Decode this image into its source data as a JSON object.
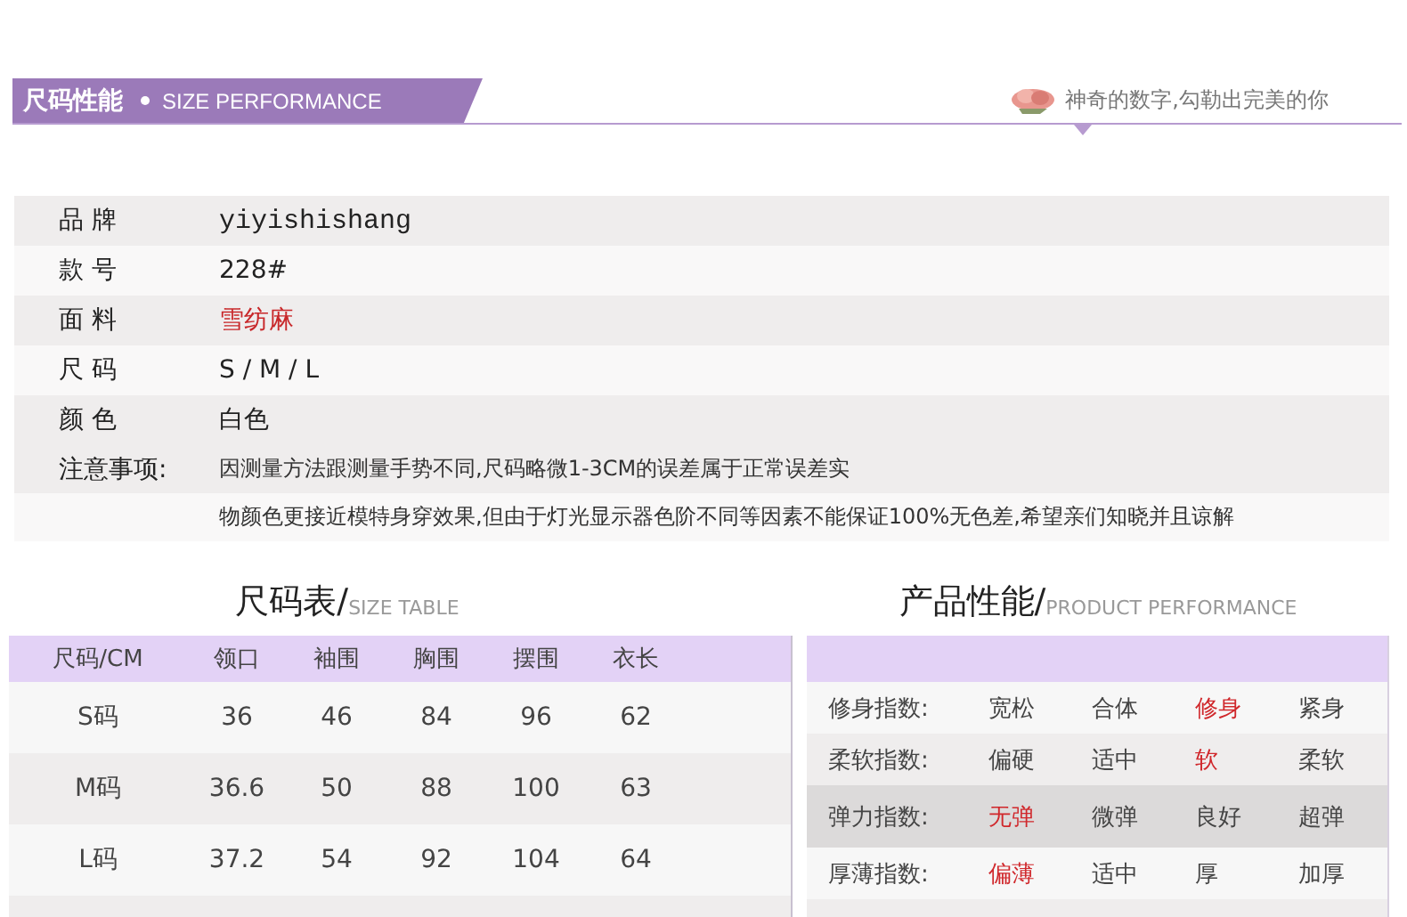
{
  "header": {
    "title": "尺码性能",
    "subtitle": "SIZE PERFORMANCE",
    "slogan": "神奇的数字,勾勒出完美的你"
  },
  "info": [
    {
      "label": "品 牌",
      "value": "yiyishishang",
      "kind": "mono"
    },
    {
      "label": "款 号",
      "value": "228#",
      "kind": "plain"
    },
    {
      "label": "面 料",
      "value": "雪纺麻",
      "kind": "highlight"
    },
    {
      "label": "尺 码",
      "value": "S / M / L",
      "kind": "plain"
    },
    {
      "label": "颜 色",
      "value": "白色",
      "kind": "plain"
    }
  ],
  "notes": {
    "label": "注意事项:",
    "lines": [
      "因测量方法跟测量手势不同,尺码略微1-3CM的误差属于正常误差实",
      "物颜色更接近模特身穿效果,但由于灯光显示器色阶不同等因素不能保证100%无色差,希望亲们知晓并且谅解"
    ]
  },
  "size_table": {
    "title": "尺码表/",
    "title_en": "SIZE TABLE",
    "columns": [
      "尺码/CM",
      "领口",
      "袖围",
      "胸围",
      "摆围",
      "衣长"
    ],
    "rows": [
      [
        "S码",
        "36",
        "46",
        "84",
        "96",
        "62"
      ],
      [
        "M码",
        "36.6",
        "50",
        "88",
        "100",
        "63"
      ],
      [
        "L码",
        "37.2",
        "54",
        "92",
        "104",
        "64"
      ]
    ]
  },
  "performance": {
    "title": "产品性能/",
    "title_en": "PRODUCT PERFORMANCE",
    "rows": [
      {
        "label": "修身指数:",
        "options": [
          {
            "text": "宽松",
            "selected": false
          },
          {
            "text": "合体",
            "selected": false
          },
          {
            "text": "修身",
            "selected": true
          },
          {
            "text": "紧身",
            "selected": false
          }
        ]
      },
      {
        "label": "柔软指数:",
        "options": [
          {
            "text": "偏硬",
            "selected": false
          },
          {
            "text": "适中",
            "selected": false
          },
          {
            "text": "软",
            "selected": true
          },
          {
            "text": "柔软",
            "selected": false
          }
        ]
      },
      {
        "label": "弹力指数:",
        "options": [
          {
            "text": "无弹",
            "selected": true
          },
          {
            "text": "微弹",
            "selected": false
          },
          {
            "text": "良好",
            "selected": false
          },
          {
            "text": "超弹",
            "selected": false
          }
        ]
      },
      {
        "label": "厚薄指数:",
        "options": [
          {
            "text": "偏薄",
            "selected": true
          },
          {
            "text": "适中",
            "selected": false
          },
          {
            "text": "厚",
            "selected": false
          },
          {
            "text": "加厚",
            "selected": false
          }
        ]
      }
    ]
  }
}
